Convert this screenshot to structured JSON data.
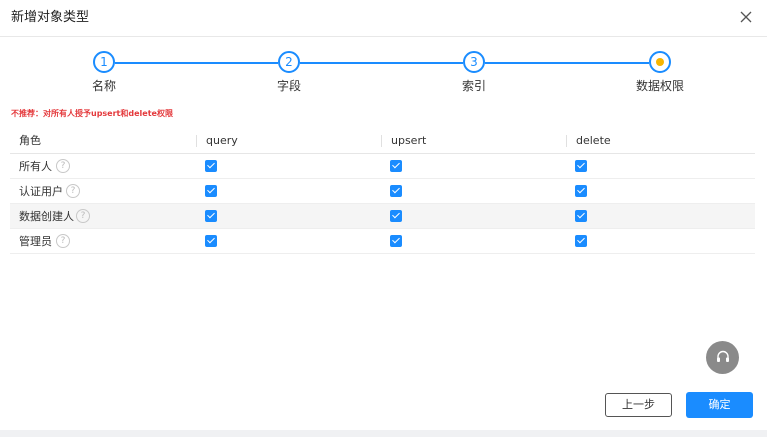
{
  "dialog": {
    "title": "新增对象类型",
    "close_icon": "close-icon"
  },
  "steps": [
    {
      "number": "1",
      "label": "名称",
      "status": "completed"
    },
    {
      "number": "2",
      "label": "字段",
      "status": "completed"
    },
    {
      "number": "3",
      "label": "索引",
      "status": "completed"
    },
    {
      "number": "",
      "label": "数据权限",
      "status": "current"
    }
  ],
  "warning": "不推荐：对所有人授予upsert和delete权限",
  "table": {
    "columns": [
      "角色",
      "query",
      "upsert",
      "delete"
    ],
    "rows": [
      {
        "role": "所有人",
        "query": true,
        "upsert": true,
        "delete": true
      },
      {
        "role": "认证用户",
        "query": true,
        "upsert": true,
        "delete": true
      },
      {
        "role": "数据创建人",
        "query": true,
        "upsert": true,
        "delete": true
      },
      {
        "role": "管理员",
        "query": true,
        "upsert": true,
        "delete": true
      }
    ],
    "help_icon": "question-circle-icon",
    "help_glyph": "?"
  },
  "footer": {
    "prev_label": "上一步",
    "confirm_label": "确定"
  },
  "support_icon": "headset-icon",
  "colors": {
    "primary": "#1a8cff",
    "warning": "#e4393c",
    "current_step_dot": "#f7b500",
    "support_button": "#8a8a8a"
  }
}
